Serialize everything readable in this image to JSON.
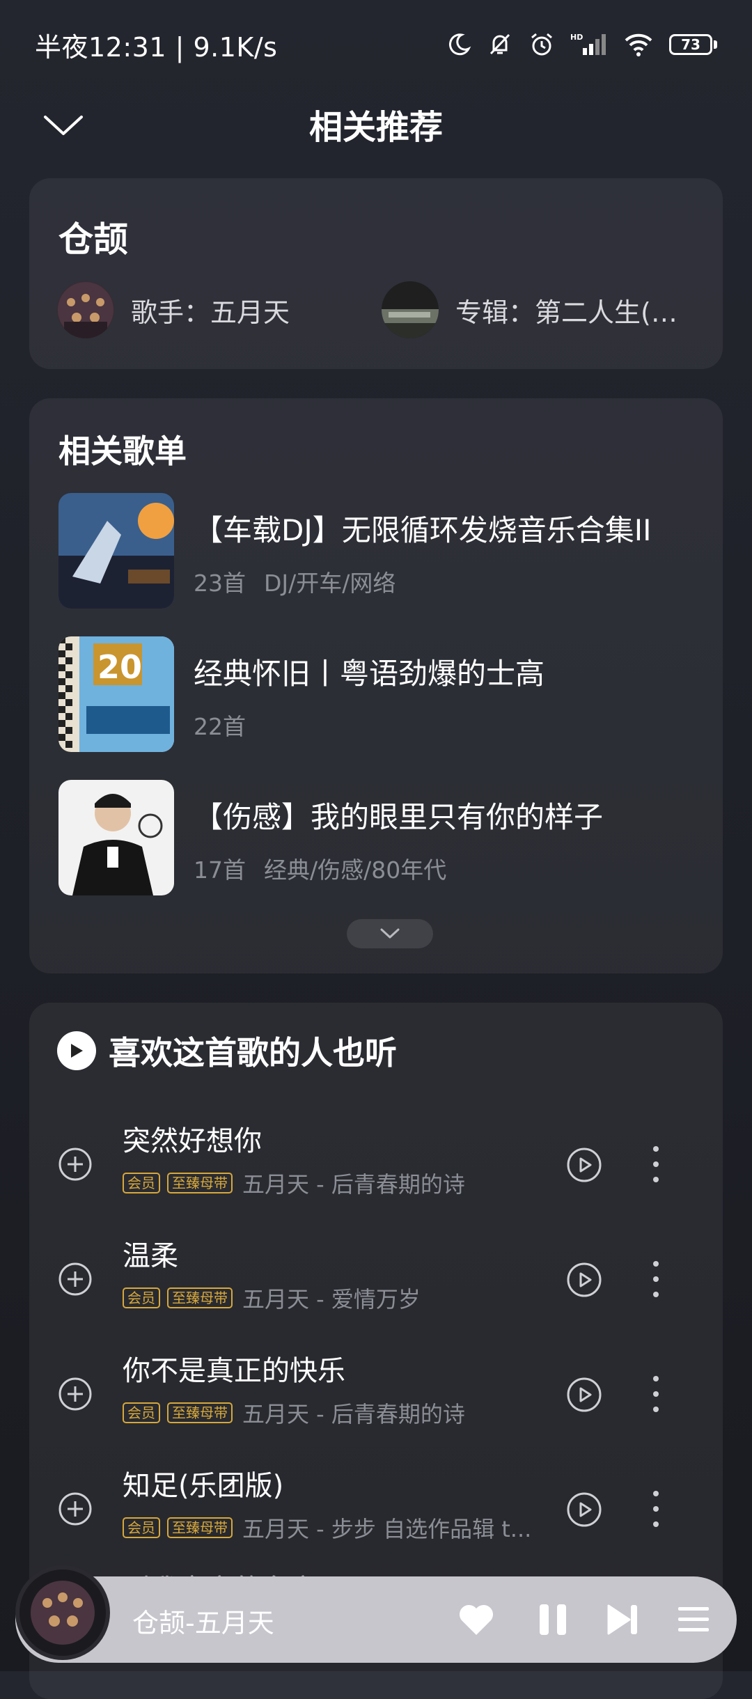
{
  "status": {
    "time": "半夜12:31 | 9.1K/s",
    "battery": "73",
    "icons": [
      "moon-icon",
      "bell-off-icon",
      "alarm-icon",
      "hd-signal-icon",
      "wifi-icon",
      "battery-icon"
    ]
  },
  "header": {
    "title": "相关推荐",
    "back_icon": "chevron-down-icon"
  },
  "song": {
    "title": "仓颉",
    "singer_label": "歌手：五月天",
    "album_label": "专辑：第二人生(…"
  },
  "playlists": {
    "title": "相关歌单",
    "items": [
      {
        "title": "【车载DJ】无限循环发烧音乐合集II",
        "count": "23首",
        "tags": "DJ/开车/网络"
      },
      {
        "title": "经典怀旧丨粤语劲爆的士高",
        "count": "22首",
        "tags": ""
      },
      {
        "title": "【伤感】我的眼里只有你的样子",
        "count": "17首",
        "tags": "经典/伤感/80年代"
      }
    ],
    "expand_icon": "chevron-down-icon"
  },
  "also_listen": {
    "title": "喜欢这首歌的人也听",
    "tag_vip": "会员",
    "tag_quality": "至臻母带",
    "songs": [
      {
        "title": "突然好想你",
        "artist": "五月天 - 后青春期的诗"
      },
      {
        "title": "温柔",
        "artist": "五月天 - 爱情万岁"
      },
      {
        "title": "你不是真正的快乐",
        "artist": "五月天 - 后青春期的诗"
      },
      {
        "title": "知足(乐团版)",
        "artist": "五月天 - 步步 自选作品辑 t..."
      }
    ],
    "peek_title": "叫我意实的名字"
  },
  "player": {
    "now_playing": "仓颉-五月天",
    "accent": "#c6c6cc"
  }
}
